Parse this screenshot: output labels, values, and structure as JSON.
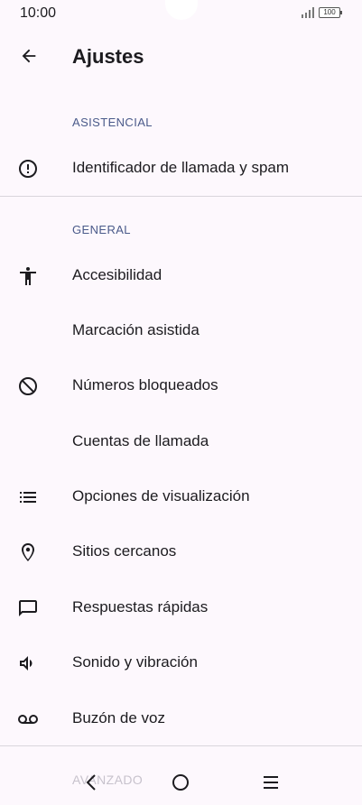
{
  "status_bar": {
    "time": "10:00",
    "battery": "100"
  },
  "app_bar": {
    "title": "Ajustes",
    "back_icon": "arrow-back-icon"
  },
  "sections": [
    {
      "header": "ASISTENCIAL",
      "items": [
        {
          "label": "Identificador de llamada y spam",
          "icon": "alert-circle-icon"
        }
      ]
    },
    {
      "header": "GENERAL",
      "items": [
        {
          "label": "Accesibilidad",
          "icon": "accessibility-icon"
        },
        {
          "label": "Marcación asistida",
          "icon": ""
        },
        {
          "label": "Números bloqueados",
          "icon": "block-icon"
        },
        {
          "label": "Cuentas de llamada",
          "icon": ""
        },
        {
          "label": "Opciones de visualización",
          "icon": "list-icon"
        },
        {
          "label": "Sitios cercanos",
          "icon": "location-pin-icon"
        },
        {
          "label": "Respuestas rápidas",
          "icon": "chat-bubble-icon"
        },
        {
          "label": "Sonido y vibración",
          "icon": "volume-icon"
        },
        {
          "label": "Buzón de voz",
          "icon": "voicemail-icon"
        }
      ]
    },
    {
      "header": "AVANZADO",
      "items": []
    }
  ],
  "nav_bar": {
    "back": "nav-back-icon",
    "home": "nav-home-icon",
    "recents": "nav-menu-icon"
  },
  "colors": {
    "background": "#fdf8fd",
    "section_header": "#4a5a8a",
    "text": "#1c1b1f",
    "divider": "#d9d6dc"
  }
}
